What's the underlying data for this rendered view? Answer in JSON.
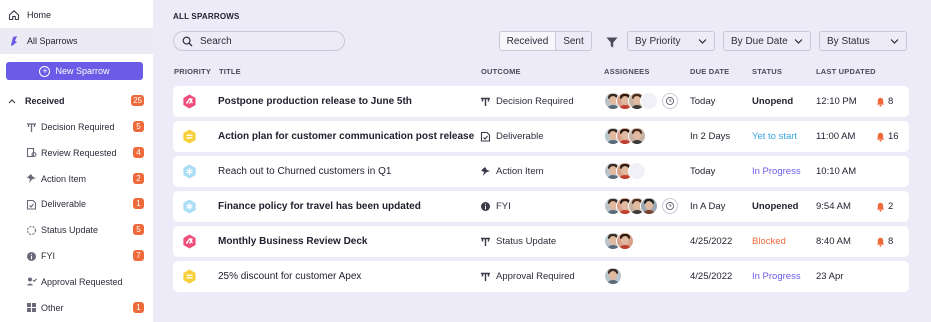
{
  "sidebar": {
    "home_label": "Home",
    "all_label": "All Sparrows",
    "new_button": "New Sparrow",
    "received_label": "Received",
    "received_count": "25",
    "items": [
      {
        "label": "Decision Required",
        "count": "5",
        "icon": "decision-icon"
      },
      {
        "label": "Review Requested",
        "count": "4",
        "icon": "review-icon"
      },
      {
        "label": "Action Item",
        "count": "2",
        "icon": "action-icon"
      },
      {
        "label": "Deliverable",
        "count": "1",
        "icon": "deliverable-icon"
      },
      {
        "label": "Status Update",
        "count": "5",
        "icon": "status-update-icon"
      },
      {
        "label": "FYI",
        "count": "7",
        "icon": "fyi-icon"
      },
      {
        "label": "Approval Requested",
        "count": "",
        "icon": "approval-icon"
      },
      {
        "label": "Other",
        "count": "1",
        "icon": "other-icon"
      }
    ]
  },
  "main": {
    "section_title": "ALL SPARROWS",
    "search_placeholder": "Search",
    "toggle": {
      "received": "Received",
      "sent": "Sent"
    },
    "filters": {
      "priority": "By Priority",
      "due": "By Due Date",
      "status": "By Status"
    },
    "columns": {
      "priority": "PRIORITY",
      "title": "TITLE",
      "outcome": "OUTCOME",
      "assignees": "ASSIGNEES",
      "due": "DUE DATE",
      "status": "STATUS",
      "updated": "LAST UPDATED"
    }
  },
  "colors": {
    "accent": "#6b5ce7",
    "urgent": "#ef4f7a",
    "medium": "#f6cf3a",
    "low": "#a9dcf5",
    "badge": "#ef6a3a",
    "in_progress": "#6b5ce7",
    "yet_to_start": "#3aa3e0",
    "blocked": "#ef6a3a",
    "bell": "#ef6a3a"
  },
  "rows": [
    {
      "priority": "urgent",
      "title": "Postpone production release  to June 5th",
      "bold": true,
      "outcome": "Decision Required",
      "outcome_icon": "decision-icon",
      "assignees": 3,
      "ghost": true,
      "assign_button": true,
      "due": "Today",
      "status": "Unopend",
      "status_style": "bold",
      "updated": "12:10 PM",
      "notifications": "8"
    },
    {
      "priority": "medium",
      "title": "Action plan for customer communication post release",
      "bold": true,
      "outcome": "Deliverable",
      "outcome_icon": "deliverable-icon",
      "assignees": 3,
      "ghost": false,
      "assign_button": false,
      "due": "In 2 Days",
      "status": "Yet to start",
      "status_style": "yet",
      "updated": "11:00 AM",
      "notifications": "16"
    },
    {
      "priority": "low",
      "title": "Reach out to Churned customers in Q1",
      "bold": false,
      "outcome": "Action Item",
      "outcome_icon": "action-icon",
      "assignees": 2,
      "ghost": true,
      "assign_button": false,
      "due": "Today",
      "status": "In Progress",
      "status_style": "progress",
      "updated": "10:10 AM",
      "notifications": ""
    },
    {
      "priority": "low",
      "title": "Finance policy for travel has been updated",
      "bold": true,
      "outcome": "FYI",
      "outcome_icon": "fyi-icon",
      "assignees": 4,
      "ghost": false,
      "assign_button": true,
      "due": "In A Day",
      "status": "Unopened",
      "status_style": "bold",
      "updated": "9:54 AM",
      "notifications": "2"
    },
    {
      "priority": "urgent",
      "title": "Monthly Business Review Deck",
      "bold": true,
      "outcome": "Status Update",
      "outcome_icon": "decision-icon",
      "assignees": 2,
      "ghost": false,
      "assign_button": false,
      "due": "4/25/2022",
      "status": "Blocked",
      "status_style": "blocked",
      "updated": "8:40 AM",
      "notifications": "8"
    },
    {
      "priority": "medium",
      "title": "25% discount for customer Apex",
      "bold": false,
      "outcome": "Approval Required",
      "outcome_icon": "decision-icon",
      "assignees": 1,
      "ghost": false,
      "assign_button": false,
      "due": "4/25/2022",
      "status": "In Progress",
      "status_style": "progress",
      "updated": "23 Apr",
      "notifications": ""
    }
  ]
}
